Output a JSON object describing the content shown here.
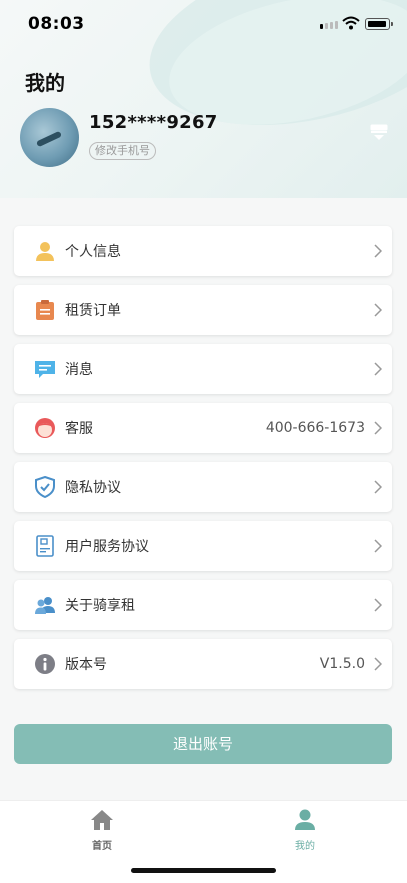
{
  "status_bar": {
    "time": "08:03"
  },
  "page": {
    "title": "我的"
  },
  "profile": {
    "phone": "152****9267",
    "edit_phone_label": "修改手机号"
  },
  "menu": {
    "items": [
      {
        "label": "个人信息",
        "value": "",
        "icon": "user-icon"
      },
      {
        "label": "租赁订单",
        "value": "",
        "icon": "clipboard-icon"
      },
      {
        "label": "消息",
        "value": "",
        "icon": "message-icon"
      },
      {
        "label": "客服",
        "value": "400-666-1673",
        "icon": "customer-service-icon"
      },
      {
        "label": "隐私协议",
        "value": "",
        "icon": "shield-check-icon"
      },
      {
        "label": "用户服务协议",
        "value": "",
        "icon": "document-icon"
      },
      {
        "label": "关于骑享租",
        "value": "",
        "icon": "users-icon"
      },
      {
        "label": "版本号",
        "value": "V1.5.0",
        "icon": "info-icon"
      }
    ]
  },
  "logout": {
    "label": "退出账号"
  },
  "tabbar": {
    "home_label": "首页",
    "mine_label": "我的"
  },
  "colors": {
    "accent": "#84bdb5",
    "accent_text": "#6aaea4"
  }
}
